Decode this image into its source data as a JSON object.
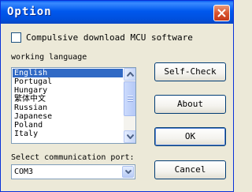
{
  "window": {
    "title": "Option"
  },
  "checkbox": {
    "label": "Compulsive download MCU software",
    "checked": false
  },
  "language": {
    "label": "working language",
    "items": [
      "English",
      "Portugal",
      "Hungary",
      "繁体中文",
      "Russian",
      "Japanese",
      "Poland",
      "Italy"
    ],
    "selected": "English"
  },
  "port": {
    "label": "Select communication port:",
    "value": "COM3"
  },
  "buttons": {
    "self_check": "Self-Check",
    "about": "About",
    "ok": "OK",
    "cancel": "Cancel"
  },
  "colors": {
    "titlebar": "#0058ee",
    "selection": "#316ac5",
    "close": "#d9542f",
    "dialog_bg": "#ece9d8"
  },
  "icons": {
    "close": "close-icon",
    "scroll_up": "arrow-up-icon",
    "scroll_down": "arrow-down-icon",
    "dropdown": "chevron-down-icon"
  }
}
